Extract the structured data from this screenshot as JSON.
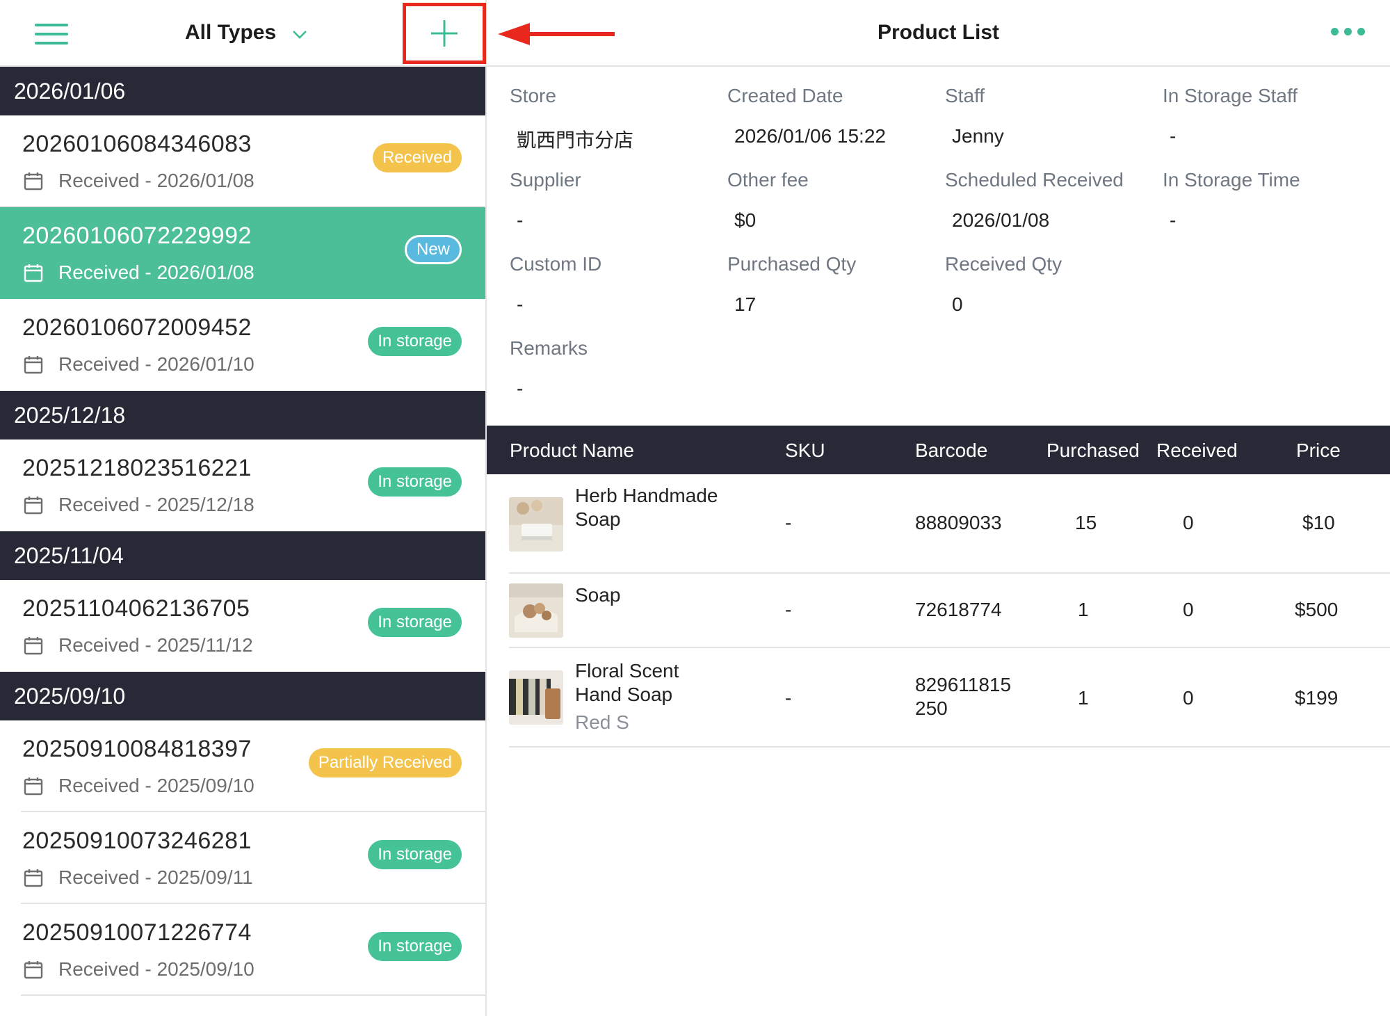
{
  "header": {
    "type_filter": "All Types",
    "title": "Product List"
  },
  "icons": {
    "menu": "hamburger-menu-icon",
    "dropdown": "chevron-down-icon",
    "add": "plus-icon",
    "annotation": "red-arrow-icon",
    "more": "more-dots-icon",
    "date": "calendar-icon"
  },
  "colors": {
    "accent": "#3dbb96",
    "dark_header": "#272a36",
    "highlight": "#e8281c",
    "received": "#f3c34c",
    "in_storage": "#46c297",
    "new": "#5ab9df"
  },
  "groups": [
    {
      "date": "2026/01/06",
      "orders": [
        {
          "id": "20260106084346083",
          "received": "Received - 2026/01/08",
          "status": "Received"
        },
        {
          "id": "20260106072229992",
          "received": "Received - 2026/01/08",
          "status": "New"
        },
        {
          "id": "20260106072009452",
          "received": "Received - 2026/01/10",
          "status": "In storage"
        }
      ]
    },
    {
      "date": "2025/12/18",
      "orders": [
        {
          "id": "20251218023516221",
          "received": "Received - 2025/12/18",
          "status": "In storage"
        }
      ]
    },
    {
      "date": "2025/11/04",
      "orders": [
        {
          "id": "20251104062136705",
          "received": "Received - 2025/11/12",
          "status": "In storage"
        }
      ]
    },
    {
      "date": "2025/09/10",
      "orders": [
        {
          "id": "20250910084818397",
          "received": "Received - 2025/09/10",
          "status": "Partially Received"
        },
        {
          "id": "20250910073246281",
          "received": "Received - 2025/09/11",
          "status": "In storage"
        },
        {
          "id": "20250910071226774",
          "received": "Received - 2025/09/10",
          "status": "In storage"
        }
      ]
    }
  ],
  "details": {
    "store": {
      "label": "Store",
      "value": "凱西門市分店"
    },
    "created": {
      "label": "Created Date",
      "value": "2026/01/06 15:22"
    },
    "staff": {
      "label": "Staff",
      "value": "Jenny"
    },
    "storage_staff": {
      "label": "In Storage Staff",
      "value": "-"
    },
    "supplier": {
      "label": "Supplier",
      "value": "-"
    },
    "other_fee": {
      "label": "Other fee",
      "value": "$0"
    },
    "scheduled": {
      "label": "Scheduled Received",
      "value": "2026/01/08"
    },
    "storage_time": {
      "label": "In Storage Time",
      "value": "-"
    },
    "custom_id": {
      "label": "Custom ID",
      "value": "-"
    },
    "purchased_qty": {
      "label": "Purchased Qty",
      "value": "17"
    },
    "received_qty": {
      "label": "Received Qty",
      "value": "0"
    },
    "remarks": {
      "label": "Remarks",
      "value": "-"
    }
  },
  "table": {
    "headers": [
      "Product Name",
      "SKU",
      "Barcode",
      "Purchased",
      "Received",
      "Price"
    ],
    "rows": [
      {
        "name_1": "Herb Handmade",
        "name_2": "Soap",
        "variant": "",
        "sku": "-",
        "barcode_1": "88809033",
        "barcode_2": "",
        "purchased": "15",
        "received": "0",
        "price": "$10"
      },
      {
        "name_1": "Soap",
        "name_2": "",
        "variant": "",
        "sku": "-",
        "barcode_1": "72618774",
        "barcode_2": "",
        "purchased": "1",
        "received": "0",
        "price": "$500"
      },
      {
        "name_1": "Floral Scent",
        "name_2": "Hand Soap",
        "variant": "Red S",
        "sku": "-",
        "barcode_1": "829611815",
        "barcode_2": "250",
        "purchased": "1",
        "received": "0",
        "price": "$199"
      }
    ]
  }
}
